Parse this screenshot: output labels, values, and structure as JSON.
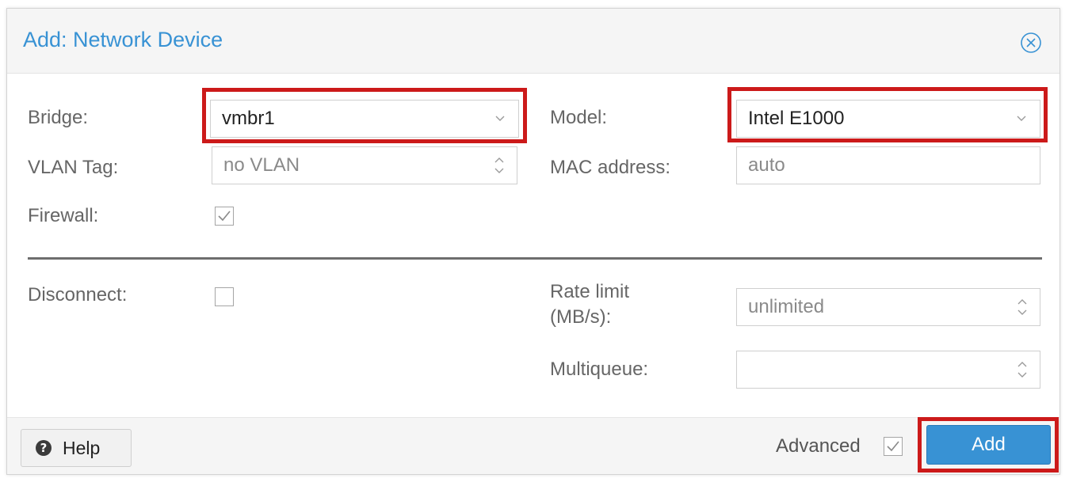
{
  "dialog": {
    "title": "Add: Network Device"
  },
  "form": {
    "bridge": {
      "label": "Bridge:",
      "value": "vmbr1"
    },
    "model": {
      "label": "Model:",
      "value": "Intel E1000"
    },
    "vlan_tag": {
      "label": "VLAN Tag:",
      "placeholder": "no VLAN"
    },
    "mac_address": {
      "label": "MAC address:",
      "placeholder": "auto"
    },
    "firewall": {
      "label": "Firewall:",
      "checked": true
    },
    "disconnect": {
      "label": "Disconnect:",
      "checked": false
    },
    "rate_limit": {
      "label_line1": "Rate limit",
      "label_line2": "(MB/s):",
      "placeholder": "unlimited"
    },
    "multiqueue": {
      "label": "Multiqueue:",
      "value": ""
    }
  },
  "footer": {
    "help_label": "Help",
    "help_icon_glyph": "?",
    "advanced_label": "Advanced",
    "advanced_checked": true,
    "add_label": "Add"
  },
  "icons": {
    "close": "close-circle-icon",
    "dropdown": "chevron-down-icon",
    "spinner": "spinner-arrows-icon",
    "check": "checkmark-icon",
    "help": "question-circle-icon"
  },
  "colors": {
    "accent": "#3892d4",
    "highlight": "#cc1a1a",
    "label": "#666666"
  }
}
